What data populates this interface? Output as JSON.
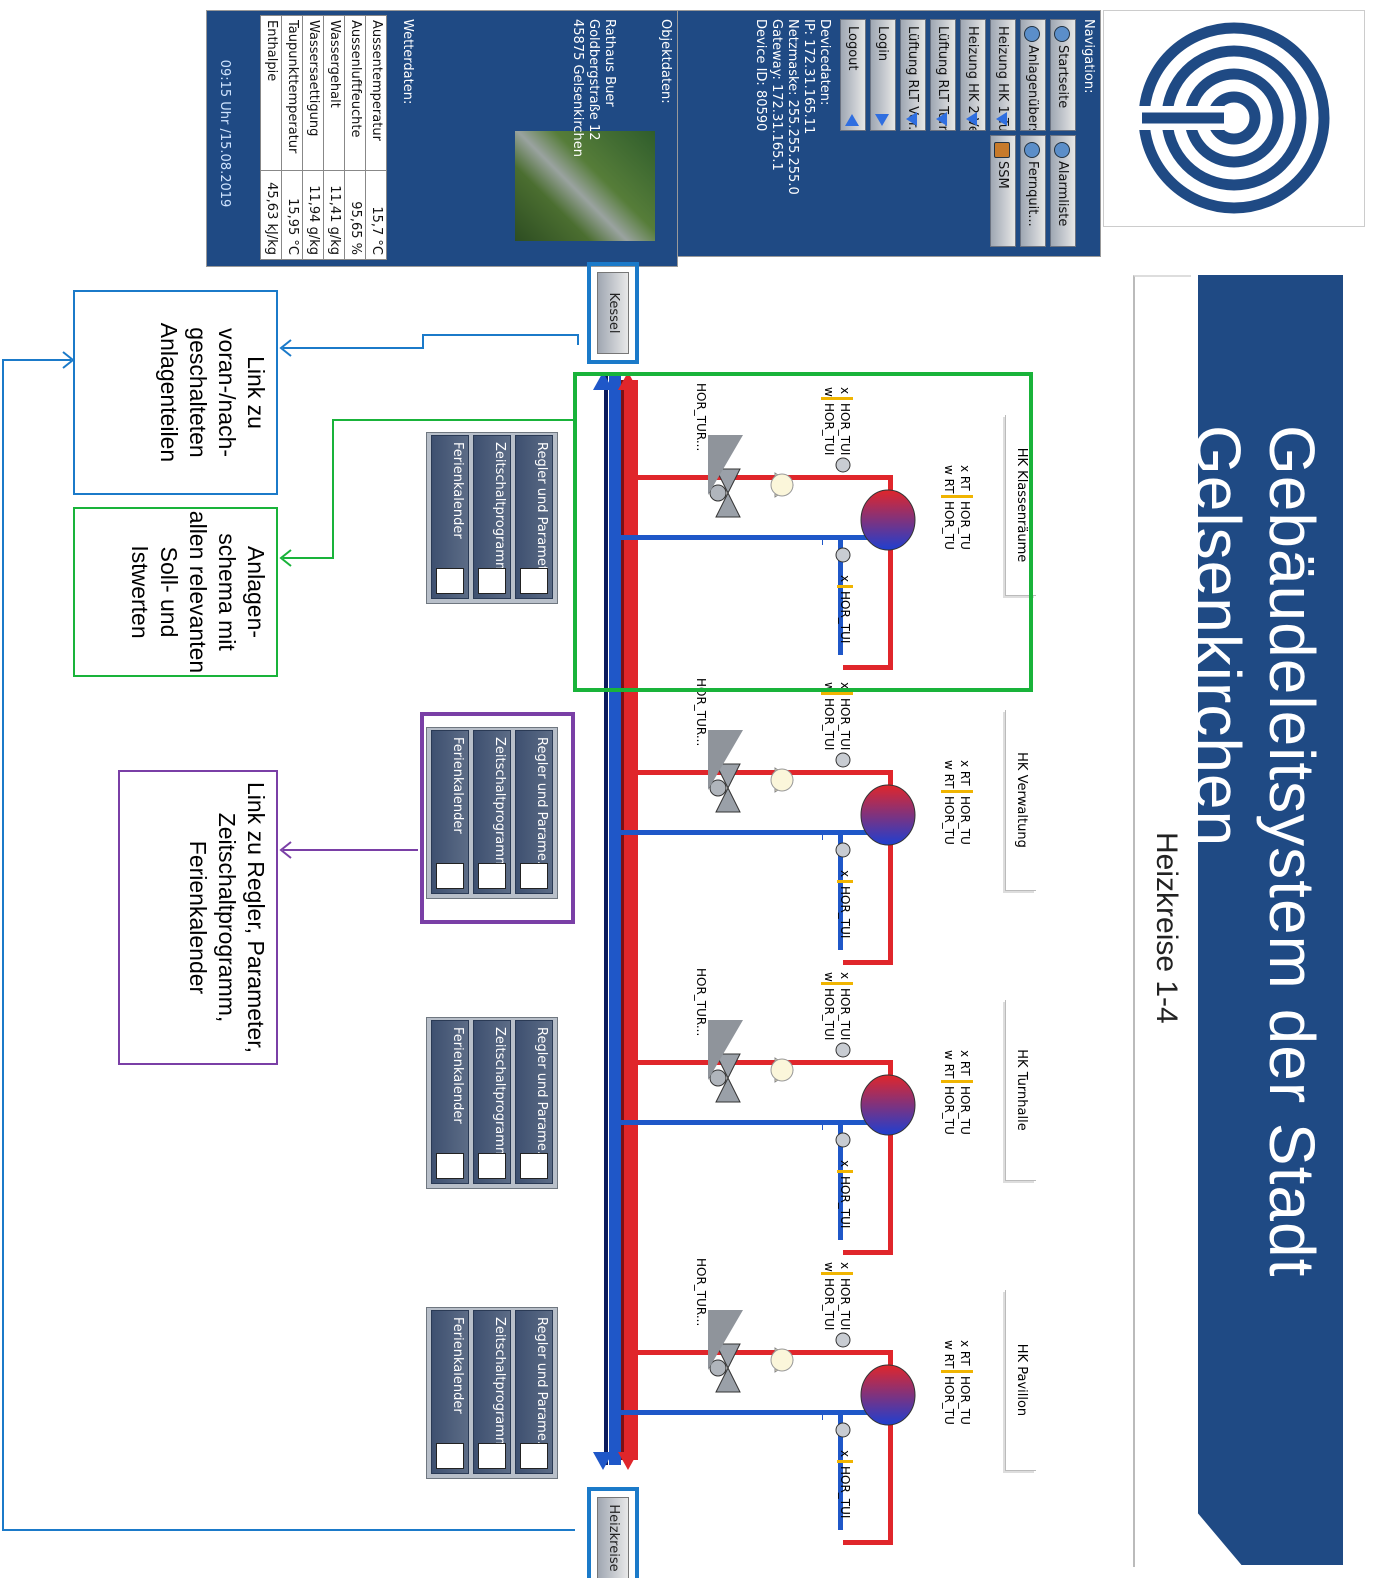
{
  "header": {
    "title": "Gebäudeleitsystem der Stadt Gelsenkirchen",
    "subtitle": "Heizkreise 1-4"
  },
  "navigation": {
    "label": "Navigation:",
    "buttons": [
      "Startseite",
      "Alarmliste",
      "Anlagenübersicht",
      "Fernquit...",
      "Heizung HK 1 Tu...",
      "SSM",
      "Heizung HK 2 Ve...",
      "Lüftung RLT Turn...",
      "Lüftung RLT Ver...",
      "Login",
      "Logout"
    ]
  },
  "device": {
    "label": "Devicedaten:",
    "ip": "IP: 172.31.165.11",
    "mask": "Netzmaske: 255.255.255.0",
    "gateway": "Gateway: 172.31.165.1",
    "device_id": "Device ID: 80590"
  },
  "object": {
    "label": "Objektdaten:",
    "name": "Rathaus Buer",
    "street": "Goldbergstraße 12",
    "city": "45875 Gelsenkirchen"
  },
  "weather": {
    "label": "Wetterdaten:",
    "rows": [
      {
        "k": "Aussentemperatur",
        "v": "15,7 °C"
      },
      {
        "k": "Aussenluftfeuchte",
        "v": "95,65 %"
      },
      {
        "k": "Wassergehalt",
        "v": "11,41 g/kg"
      },
      {
        "k": "Wassersaettigung",
        "v": "11,94 g/kg"
      },
      {
        "k": "Taupunkttemperatur",
        "v": "15,95 °C"
      },
      {
        "k": "Enthalpie",
        "v": "45,63 kJ/kg"
      }
    ],
    "timestamp": "09:15 Uhr /15.08.2019"
  },
  "scheme": {
    "kessel": "Kessel",
    "heizkreise": "Heizkreise",
    "circuits": [
      {
        "name": "HK Klassenräume"
      },
      {
        "name": "HK Verwaltung"
      },
      {
        "name": "HK Turnhalle"
      },
      {
        "name": "HK Pavillon"
      }
    ],
    "labels": {
      "x": "x",
      "w": "w",
      "hor": "HOR_TUI",
      "xrt": "x RT",
      "wrt": "w RT",
      "hortu": "HOR_TU",
      "valve": "HOR_TUR..."
    },
    "controls": [
      [
        "Regler und Parameter",
        "Zeitschaltprogramm",
        "Ferienkalender"
      ],
      [
        "Regler und Parame...",
        "Zeitschaltprogramm",
        "Ferienkalender"
      ],
      [
        "Regler und Parame...",
        "Zeitschaltprogramm",
        "Ferienkalender"
      ],
      [
        "Regler und Parame...",
        "Zeitschaltprogramm",
        "Ferienkalender"
      ]
    ]
  },
  "callouts": {
    "link": "Link zu voran-/nach-geschalteten Anlagenteilen",
    "schema": "Anlagen-schema mit allen relevanten Soll- und Istwerten",
    "regler": "Link zu Regler, Parameter, Zeitschaltprogramm, Ferienkalender"
  },
  "colors": {
    "accent": "#1f4a84",
    "supply": "#e0262b",
    "return": "#1f57c8",
    "green": "#19b33a",
    "purple": "#7a3fa6",
    "link_blue": "#1b7ac9"
  }
}
